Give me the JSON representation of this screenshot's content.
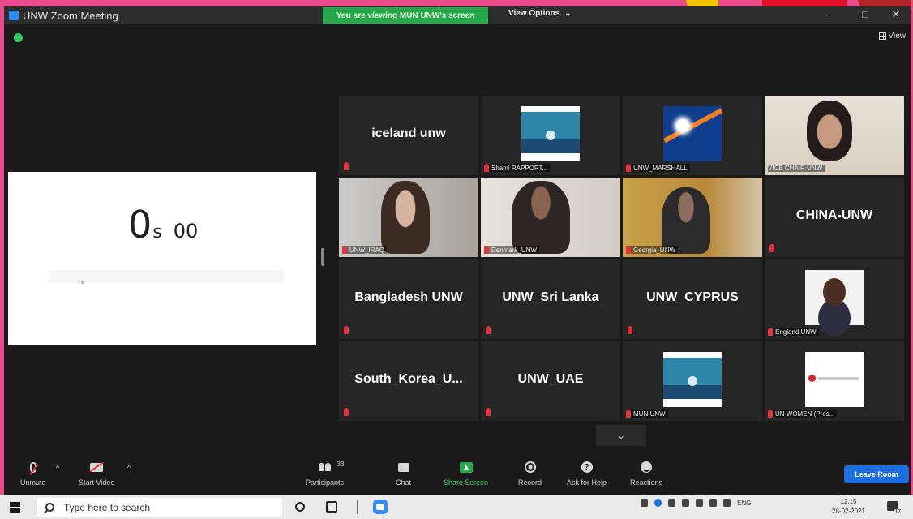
{
  "window": {
    "title": "UNW  Zoom Meeting",
    "banner": "You are viewing MUN UNW's screen",
    "view_options": "View Options",
    "view_options_caret": "⌄",
    "controls": [
      "—",
      "□",
      "✕"
    ],
    "view_label": "View"
  },
  "shared_screen": {
    "timer_big": "0",
    "timer_unit": "s",
    "timer_small": "00"
  },
  "gallery": {
    "tiles": [
      {
        "name": "iceland unw",
        "label": ""
      },
      {
        "name": "",
        "label": "Shami RAPPORT..."
      },
      {
        "name": "",
        "label": "UNW_MARSHALL"
      },
      {
        "name": "",
        "label": "VICE CHAIR UNW"
      },
      {
        "name": "",
        "label": "UNW_IRAQ"
      },
      {
        "name": "",
        "label": "Denmark_UNW"
      },
      {
        "name": "",
        "label": "Georgia_UNW"
      },
      {
        "name": "CHINA-UNW",
        "label": ""
      },
      {
        "name": "Bangladesh UNW",
        "label": ""
      },
      {
        "name": "UNW_Sri Lanka",
        "label": ""
      },
      {
        "name": "UNW_CYPRUS",
        "label": ""
      },
      {
        "name": "",
        "label": "England UNW"
      },
      {
        "name": "South_Korea_U...",
        "label": ""
      },
      {
        "name": "UNW_UAE",
        "label": ""
      },
      {
        "name": "",
        "label": "MUN UNW"
      },
      {
        "name": "",
        "label": "UN WOMEN (Pres..."
      }
    ],
    "scroll_down": "⌄"
  },
  "toolbar": {
    "unmute": "Unmute",
    "start_video": "Start Video",
    "participants": "Participants",
    "participants_count": "33",
    "chat": "Chat",
    "share_screen": "Share Screen",
    "record": "Record",
    "ask_for_help": "Ask for Help",
    "help_glyph": "?",
    "reactions": "Reactions",
    "leave": "Leave Room",
    "caret": "^"
  },
  "taskbar": {
    "search_placeholder": "Type here to search",
    "lang": "ENG",
    "time": "12:15",
    "date": "28-02-2021"
  },
  "colors": {
    "accent_green": "#25a84a",
    "leave_blue": "#1d6fe0",
    "active_speaker": "#c9e65a",
    "muted_red": "#e5323c",
    "desktop_pink": "#ea4c89"
  }
}
